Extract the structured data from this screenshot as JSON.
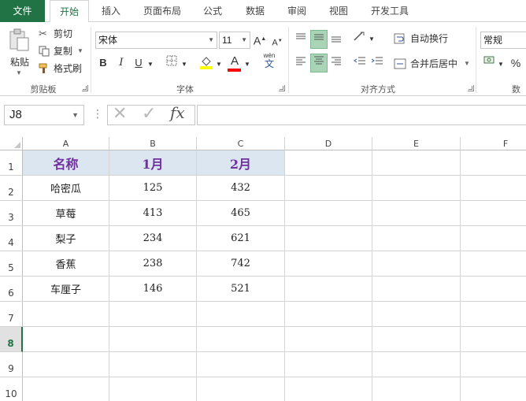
{
  "tabs": [
    {
      "label": "文件",
      "kind": "file"
    },
    {
      "label": "开始",
      "kind": "active"
    },
    {
      "label": "插入"
    },
    {
      "label": "页面布局"
    },
    {
      "label": "公式"
    },
    {
      "label": "数据"
    },
    {
      "label": "审阅"
    },
    {
      "label": "视图"
    },
    {
      "label": "开发工具"
    }
  ],
  "ribbon": {
    "clipboard": {
      "paste_label": "粘贴",
      "cut_label": "剪切",
      "copy_label": "复制",
      "format_painter_label": "格式刷",
      "group_label": "剪贴板"
    },
    "font": {
      "font_name": "宋体",
      "font_size": "11",
      "bold": "B",
      "italic": "I",
      "underline": "U",
      "grow": "A",
      "shrink": "A",
      "font_color_letter": "A",
      "wen": "wén",
      "wen_char": "文",
      "group_label": "字体",
      "fill_color": "#ffff00",
      "font_color": "#ff0000"
    },
    "alignment": {
      "wrap_label": "自动换行",
      "merge_label": "合并后居中",
      "group_label": "对齐方式"
    },
    "number": {
      "format": "常规",
      "percent": "%",
      "group_label": "数"
    }
  },
  "formula_bar": {
    "name_box": "J8",
    "fx": "fx",
    "formula": ""
  },
  "sheet": {
    "columns": [
      "A",
      "B",
      "C",
      "D",
      "E",
      "F"
    ],
    "rows": [
      "1",
      "2",
      "3",
      "4",
      "5",
      "6",
      "7",
      "8",
      "9",
      "10"
    ],
    "selected_row": "8",
    "header": [
      "名称",
      "1月",
      "2月"
    ],
    "data": [
      [
        "哈密瓜",
        "125",
        "432"
      ],
      [
        "草莓",
        "413",
        "465"
      ],
      [
        "梨子",
        "234",
        "621"
      ],
      [
        "香蕉",
        "238",
        "742"
      ],
      [
        "车厘子",
        "146",
        "521"
      ]
    ],
    "header_fill": "#dce6f1",
    "header_text_color": "#7030a0"
  }
}
